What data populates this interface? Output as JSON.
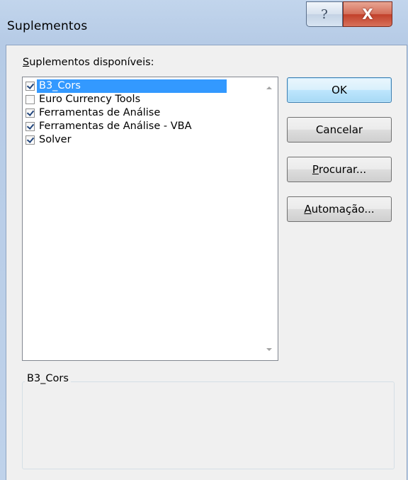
{
  "window": {
    "title": "Suplementos",
    "help_glyph": "?",
    "close_glyph": "X"
  },
  "list": {
    "label_underlined": "S",
    "label_rest": "uplementos disponíveis:",
    "items": [
      {
        "label": "B3_Cors",
        "checked": true,
        "selected": true
      },
      {
        "label": "Euro Currency Tools",
        "checked": false,
        "selected": false
      },
      {
        "label": "Ferramentas de Análise",
        "checked": true,
        "selected": false
      },
      {
        "label": "Ferramentas de Análise - VBA",
        "checked": true,
        "selected": false
      },
      {
        "label": "Solver",
        "checked": true,
        "selected": false
      }
    ]
  },
  "buttons": {
    "ok": "OK",
    "cancel": "Cancelar",
    "browse_underlined": "P",
    "browse_rest": "rocurar...",
    "automation_underlined": "A",
    "automation_rest": "utomação..."
  },
  "description": {
    "caption": "B3_Cors",
    "text": ""
  },
  "colors": {
    "selection": "#3399ff",
    "default_button_border": "#3c7fb1",
    "close_button": "#c1402a"
  }
}
